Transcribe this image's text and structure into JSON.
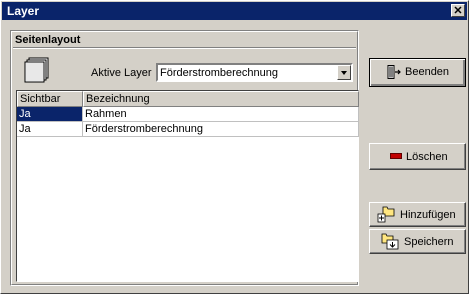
{
  "window": {
    "title": "Layer"
  },
  "group": {
    "title": "Seitenlayout"
  },
  "active_layer": {
    "label": "Aktive Layer",
    "value": "Förderstromberechnung"
  },
  "table": {
    "columns": [
      "Sichtbar",
      "Bezeichnung"
    ],
    "rows": [
      {
        "sichtbar": "Ja",
        "bezeichnung": "Rahmen"
      },
      {
        "sichtbar": "Ja",
        "bezeichnung": "Förderstromberechnung"
      }
    ]
  },
  "buttons": {
    "beenden": "Beenden",
    "loeschen": "Löschen",
    "hinzufuegen": "Hinzufügen",
    "speichern": "Speichern"
  },
  "icons": {
    "close": "close-icon",
    "layer": "layer-stack-icon",
    "exit": "door-exit-icon",
    "delete": "minus-icon",
    "add": "folder-add-icon",
    "save": "folder-save-icon"
  },
  "colors": {
    "selection": "#0a246a",
    "face": "#d4d0c8",
    "delete_red": "#c00000"
  }
}
